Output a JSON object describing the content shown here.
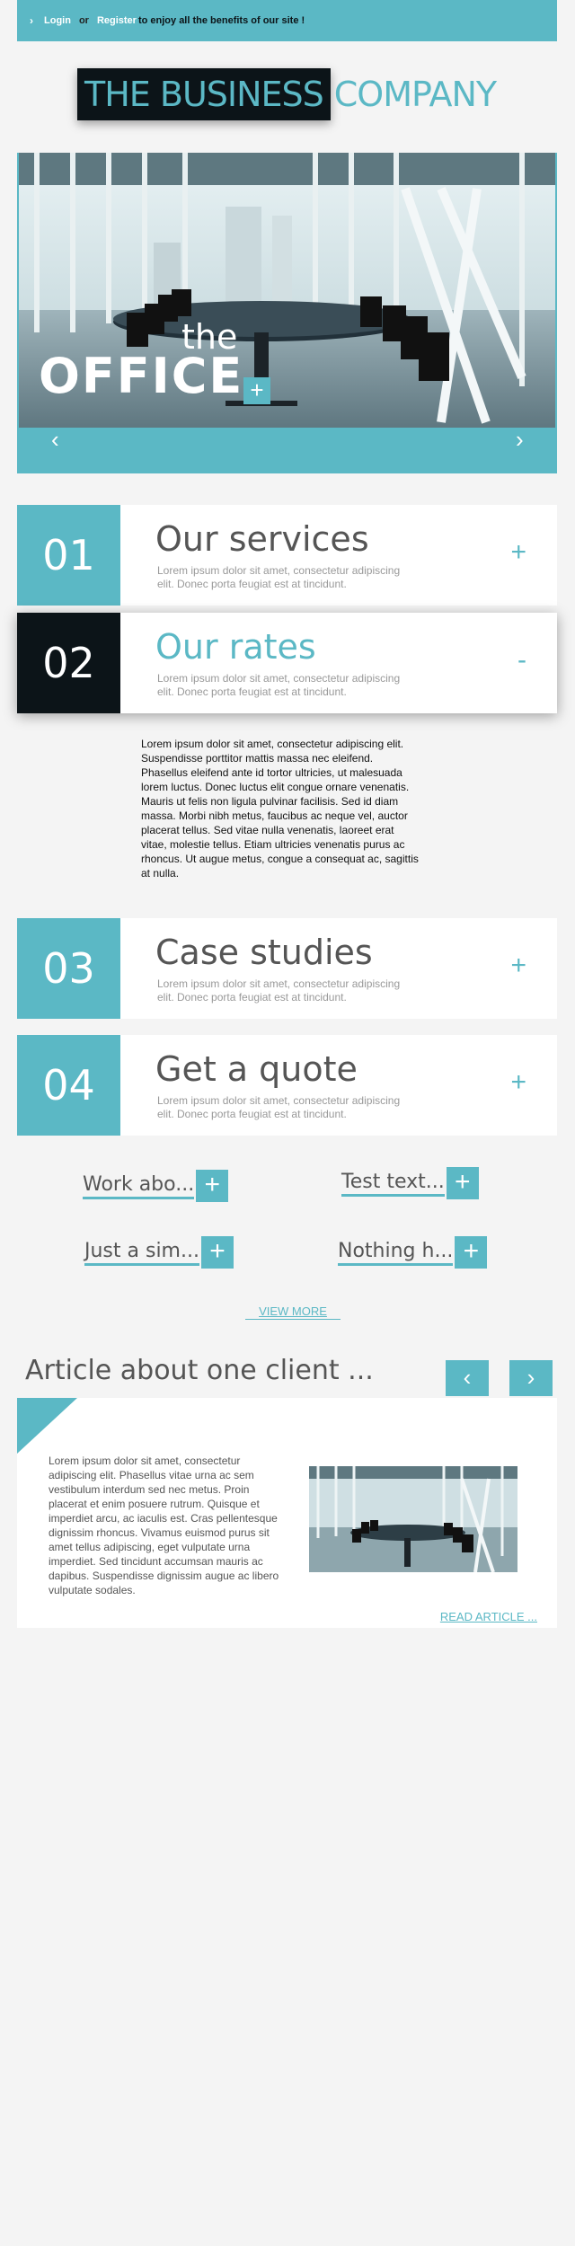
{
  "topbar": {
    "chevron": "›",
    "login": "Login",
    "or": "or",
    "register": "Register",
    "rest": "to enjoy all the benefits of our site !"
  },
  "logo": {
    "dark": "THE BUSINESS",
    "light": "COMPANY"
  },
  "hero": {
    "the": "the",
    "office": "OFFICE",
    "plus": "+",
    "prev": "‹",
    "next": "›"
  },
  "accordion": [
    {
      "num": "01",
      "title": "Our services",
      "desc": "Lorem ipsum dolor sit amet, consectetur adipiscing elit. Donec porta feugiat est at tincidunt.",
      "toggle": "+"
    },
    {
      "num": "02",
      "title": "Our rates",
      "desc": "Lorem ipsum dolor sit amet, consectetur adipiscing elit. Donec porta feugiat est at tincidunt.",
      "toggle": "-"
    },
    {
      "num": "03",
      "title": "Case studies",
      "desc": "Lorem ipsum dolor sit amet, consectetur adipiscing elit. Donec porta feugiat est at tincidunt.",
      "toggle": "+"
    },
    {
      "num": "04",
      "title": "Get a quote",
      "desc": "Lorem ipsum dolor sit amet, consectetur adipiscing elit. Donec porta feugiat est at tincidunt.",
      "toggle": "+"
    }
  ],
  "rates_body": "Lorem ipsum dolor sit amet, consectetur adipiscing elit. Suspendisse porttitor mattis massa nec eleifend. Phasellus eleifend ante id tortor ultricies, ut malesuada lorem luctus. Donec luctus elit congue ornare venenatis. Mauris ut felis non ligula pulvinar facilisis. Sed id diam massa. Morbi nibh metus, faucibus ac neque vel, auctor placerat tellus. Sed vitae nulla venenatis, laoreet erat vitae, molestie tellus. Etiam ultricies venenatis purus ac rhoncus. Ut augue metus, congue a consequat ac, sagittis at nulla.",
  "tags": [
    {
      "label": "Work abo...",
      "plus": "+"
    },
    {
      "label": "Test text...",
      "plus": "+"
    },
    {
      "label": "Just a sim...",
      "plus": "+"
    },
    {
      "label": "Nothing h...",
      "plus": "+"
    }
  ],
  "view_more": "VIEW MORE",
  "article": {
    "title": "Article about one client ...",
    "prev": "‹",
    "next": "›",
    "body": "Lorem ipsum dolor sit amet, consectetur adipiscing elit. Phasellus vitae urna ac sem vestibulum interdum sed nec metus. Proin placerat et enim posuere rutrum. Quisque et imperdiet arcu, ac iaculis est. Cras pellentesque dignissim rhoncus. Vivamus euismod purus sit amet tellus adipiscing, eget vulputate urna imperdiet. Sed tincidunt accumsan mauris ac dapibus. Suspendisse dignissim augue ac libero vulputate sodales.",
    "read": "READ ARTICLE ..."
  },
  "colors": {
    "accent": "#5bb8c5",
    "dark": "#0c1418",
    "background": "#f4f4f4"
  }
}
